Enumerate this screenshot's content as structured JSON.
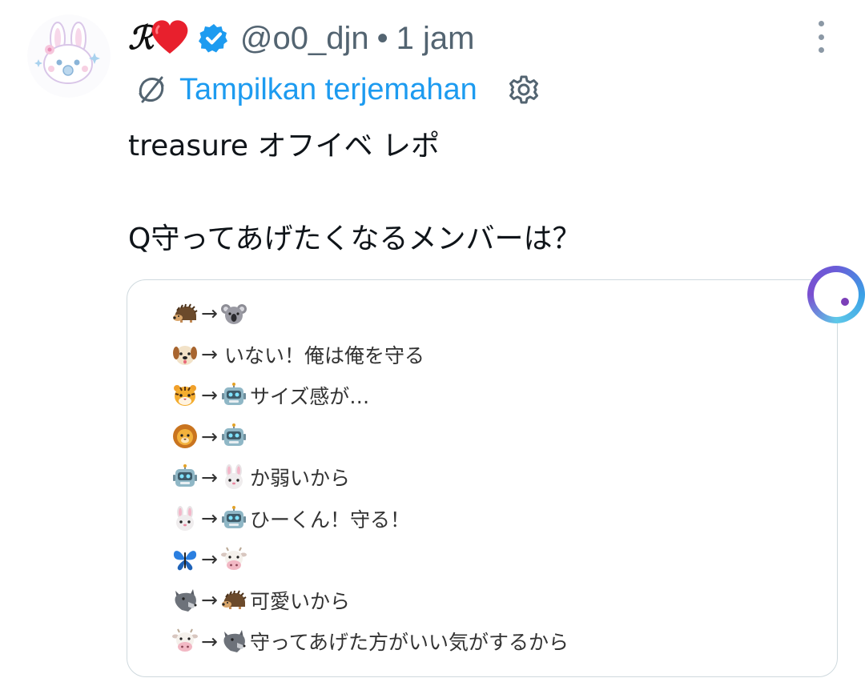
{
  "author": {
    "display_name": "ℛ",
    "handle": "@o0_djn",
    "separator": "•",
    "time": "1 jam",
    "verified_color": "#1d9bf0"
  },
  "translate": {
    "label": "Tampilkan terjemahan",
    "link_color": "#1d9bf0"
  },
  "tweet": {
    "line1": "treasure オフイベ レポ",
    "line2": "Q守ってあげたくなるメンバーは？"
  },
  "card": {
    "arrow": "→",
    "rows": [
      {
        "from": "hedgehog",
        "to": "koala",
        "text": ""
      },
      {
        "from": "dog",
        "to": "",
        "text": "いない！俺は俺を守る"
      },
      {
        "from": "tiger",
        "to": "robot",
        "text": "サイズ感が…"
      },
      {
        "from": "lion",
        "to": "robot",
        "text": ""
      },
      {
        "from": "robot",
        "to": "rabbit",
        "text": "か弱いから"
      },
      {
        "from": "rabbit",
        "to": "robot",
        "text": "ひーくん！守る！"
      },
      {
        "from": "butterfly",
        "to": "cow",
        "text": ""
      },
      {
        "from": "wolf",
        "to": "hedgehog",
        "text": "可愛いから"
      },
      {
        "from": "cow",
        "to": "wolf",
        "text": "守ってあげた方がいい気がするから"
      }
    ]
  },
  "icons": {
    "translate": "translate-icon",
    "settings": "gear-icon",
    "more": "more-vertical-icon",
    "floating": "floating-circle-icon"
  }
}
